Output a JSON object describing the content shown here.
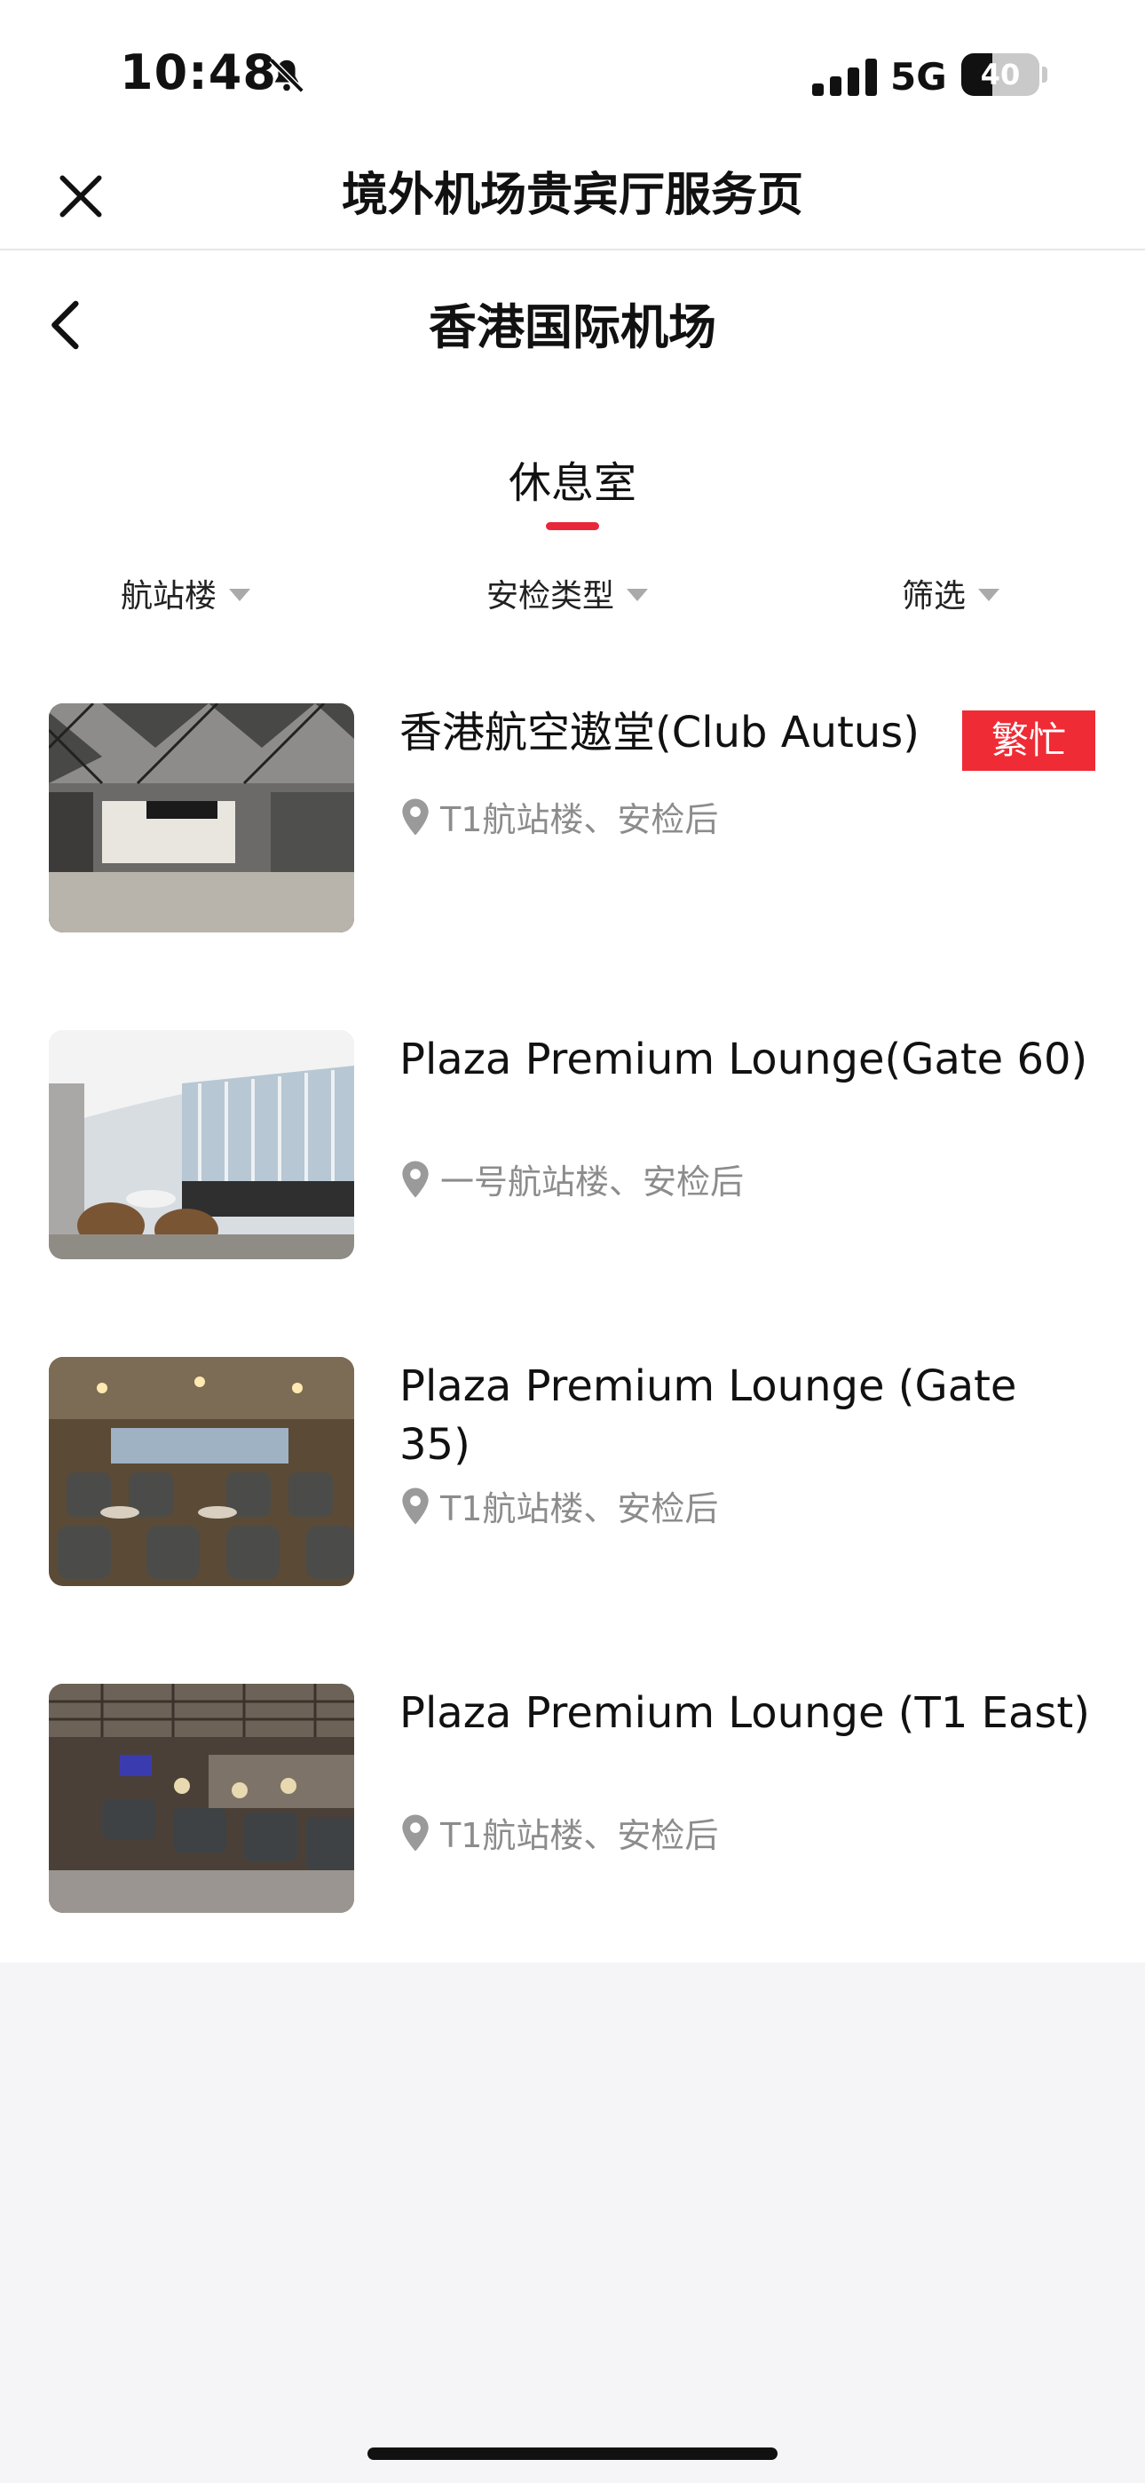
{
  "status": {
    "time": "10:48",
    "network": "5G",
    "battery": "40",
    "battery_level": 0.4
  },
  "header": {
    "title": "境外机场贵宾厅服务页"
  },
  "page": {
    "airport": "香港国际机场",
    "tab": "休息室"
  },
  "filters": [
    {
      "label": "航站楼"
    },
    {
      "label": "安检类型"
    },
    {
      "label": "筛选"
    }
  ],
  "lounges": [
    {
      "name": "香港航空遨堂(Club Autus)",
      "badge": "繁忙",
      "location": "T1航站楼、安检后"
    },
    {
      "name": "Plaza Premium Lounge(Gate 60)",
      "badge": "",
      "location": "一号航站楼、安检后"
    },
    {
      "name": "Plaza Premium Lounge (Gate 35)",
      "badge": "",
      "location": "T1航站楼、安检后"
    },
    {
      "name": "Plaza Premium Lounge (T1 East)",
      "badge": "",
      "location": "T1航站楼、安检后"
    }
  ],
  "colors": {
    "accent": "#e8283a",
    "badge": "#ef2b35",
    "muted": "#8c8c8c"
  }
}
